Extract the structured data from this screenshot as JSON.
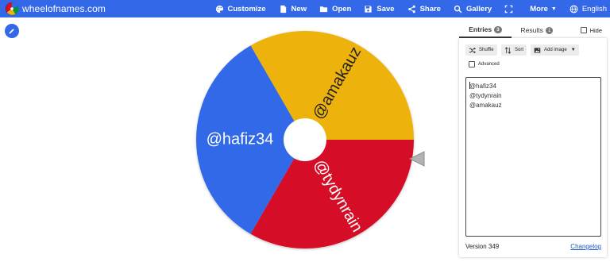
{
  "app": {
    "brand": "wheelofnames.com"
  },
  "nav": [
    {
      "label": "Customize",
      "icon": "palette-icon"
    },
    {
      "label": "New",
      "icon": "new-file-icon"
    },
    {
      "label": "Open",
      "icon": "folder-icon"
    },
    {
      "label": "Save",
      "icon": "save-icon"
    },
    {
      "label": "Share",
      "icon": "share-icon"
    },
    {
      "label": "Gallery",
      "icon": "search-icon"
    },
    {
      "label": "",
      "icon": "fullscreen-icon"
    },
    {
      "label": "More",
      "icon": "caret-down-icon"
    },
    {
      "label": "English",
      "icon": "globe-icon"
    }
  ],
  "wheel": {
    "segments": [
      {
        "label": "@amakauz",
        "color": "#eeb211"
      },
      {
        "label": "@tydynrain",
        "color": "#d50f25"
      },
      {
        "label": "@hafiz34",
        "color": "#3369e8"
      }
    ]
  },
  "panel": {
    "tabs": {
      "entries_label": "Entries",
      "entries_count": "3",
      "results_label": "Results",
      "results_count": "1"
    },
    "hide_label": "Hide",
    "tools": {
      "shuffle": "Shuffle",
      "sort": "Sort",
      "add_image": "Add image"
    },
    "advanced_label": "Advanced",
    "entries": [
      "@hafiz34",
      "@tydynrain",
      "@amakauz"
    ],
    "version": "Version 349",
    "changelog": "Changelog"
  },
  "colors": {
    "topbar": "#3369e8",
    "yellow": "#eeb211",
    "red": "#d50f25",
    "blue": "#3369e8"
  }
}
